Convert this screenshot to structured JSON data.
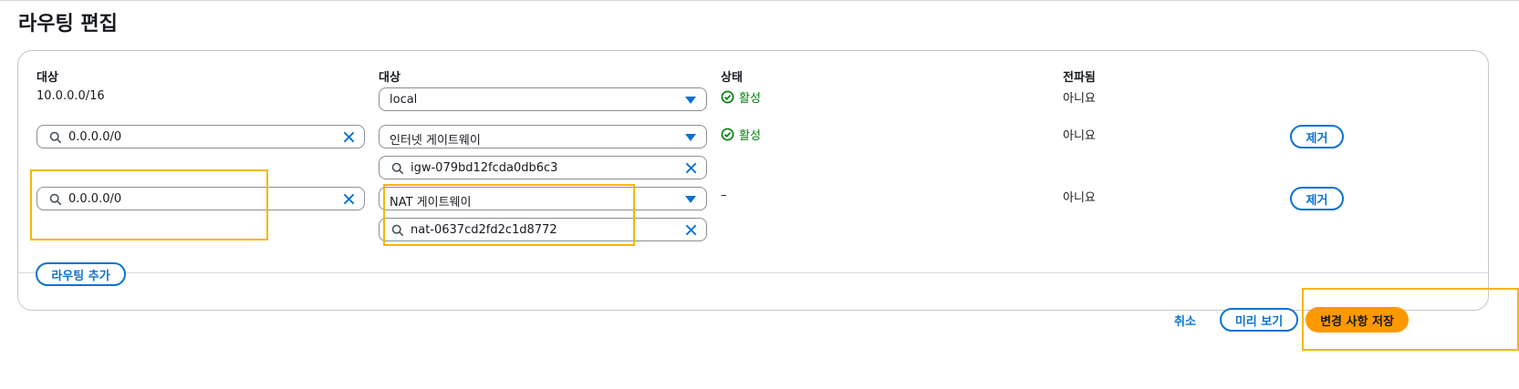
{
  "page": {
    "title": "라우팅 편집"
  },
  "columns": {
    "destination": "대상",
    "target": "대상",
    "status": "상태",
    "propagated": "전파됨"
  },
  "routes": [
    {
      "destination": "10.0.0.0/16",
      "target_type": "local",
      "status": "활성",
      "propagated": "아니요"
    },
    {
      "destination": "0.0.0.0/0",
      "target_type": "인터넷 게이트웨이",
      "target_id": "igw-079bd12fcda0db6c3",
      "status": "활성",
      "propagated": "아니요",
      "remove_label": "제거"
    },
    {
      "destination": "0.0.0.0/0",
      "target_type": "NAT 게이트웨이",
      "target_id": "nat-0637cd2fd2c1d8772",
      "status": "–",
      "propagated": "아니요",
      "remove_label": "제거"
    }
  ],
  "add_route_label": "라우팅 추가",
  "footer": {
    "cancel_label": "취소",
    "preview_label": "미리 보기",
    "save_label": "변경 사항 저장"
  },
  "colors": {
    "accent": "#0972d3",
    "success": "#037f0c",
    "primary": "#ff9900",
    "highlight": "#f5b800"
  },
  "icons": [
    "search-icon",
    "clear-icon",
    "dropdown-caret-icon",
    "status-check-icon"
  ]
}
